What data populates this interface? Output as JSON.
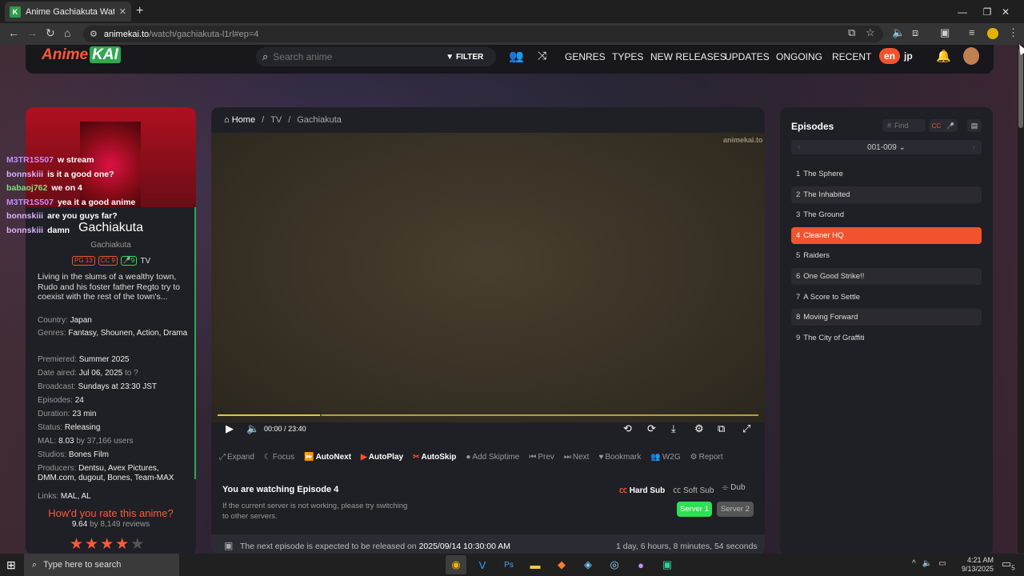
{
  "browser": {
    "tab_title": "Anime Gachiakuta Watch Online",
    "tab_favicon": "K",
    "url_host": "animekai.to",
    "url_path": "/watch/gachiakuta-l1rl#ep=4"
  },
  "site": {
    "logo_anime": "Anime",
    "logo_kai": "KAI",
    "search_placeholder": "Search anime",
    "filter_label": "FILTER",
    "nav": [
      "GENRES",
      "TYPES",
      "NEW RELEASES",
      "UPDATES",
      "ONGOING",
      "RECENT"
    ],
    "lang_en": "en",
    "lang_jp": "jp"
  },
  "anime": {
    "title": "Gachiakuta",
    "subtitle": "Gachiakuta",
    "rating_badge": "PG 13",
    "cc_badge": "CC 9",
    "dub_badge": "9",
    "type": "TV",
    "description": "Living in the slums of a wealthy town, Rudo and his foster father Regto try to coexist with the rest of the town's...",
    "meta": [
      {
        "k": "Country:",
        "v": "Japan"
      },
      {
        "k": "Genres:",
        "v": "Fantasy, Shounen, Action, Drama"
      },
      {
        "k": "Premiered:",
        "v": "Summer 2025"
      },
      {
        "k": "Date aired:",
        "v": "Jul 06, 2025",
        "extra": "to ?"
      },
      {
        "k": "Broadcast:",
        "v": "Sundays at 23:30 JST"
      },
      {
        "k": "Episodes:",
        "v": "24"
      },
      {
        "k": "Duration:",
        "v": "23 min"
      },
      {
        "k": "Status:",
        "v": "Releasing"
      },
      {
        "k": "MAL:",
        "v": "8.03",
        "extra": "by 37,166 users"
      },
      {
        "k": "Studios:",
        "v": "Bones Film"
      },
      {
        "k": "Producers:",
        "v": "Dentsu, Avex Pictures, DMM.com, dugout, Bones, Team-MAX"
      },
      {
        "k": "Links:",
        "v": "MAL, AL"
      }
    ],
    "rate_heading": "How'd you rate this anime?",
    "rate_score": "9.64",
    "rate_reviews": "by 8,149 reviews",
    "stars_filled": 4,
    "stars_total": 5
  },
  "chat": [
    {
      "user": "M3TR1S507",
      "msg": "w stream",
      "color": "#c58cff"
    },
    {
      "user": "bonnskiii",
      "msg": "is it a good one?",
      "color": "#d9b3ff"
    },
    {
      "user": "babaoj762",
      "msg": "we on 4",
      "color": "#7fe07f"
    },
    {
      "user": "M3TR1S507",
      "msg": "yea it a good anime",
      "color": "#c58cff"
    },
    {
      "user": "bonnskiii",
      "msg": "are you guys far?",
      "color": "#d9b3ff"
    },
    {
      "user": "bonnskiii",
      "msg": "damn",
      "color": "#d9b3ff"
    }
  ],
  "player": {
    "breadcrumb": [
      "Home",
      "TV",
      "Gachiakuta"
    ],
    "watermark": "animekai.to",
    "time_current": "00:00",
    "time_sep": "/",
    "time_total": "23:40",
    "progress_fraction": 0.19,
    "actions": [
      {
        "label": "Expand",
        "icon": "expand-icon",
        "glyph": "⤢",
        "on": false
      },
      {
        "label": "Focus",
        "icon": "moon-icon",
        "glyph": "☾",
        "on": false
      },
      {
        "label": "AutoNext",
        "icon": "fast-forward-icon",
        "glyph": "⏩",
        "on": true
      },
      {
        "label": "AutoPlay",
        "icon": "play-circle-icon",
        "glyph": "▶",
        "on": true
      },
      {
        "label": "AutoSkip",
        "icon": "scissors-icon",
        "glyph": "✂",
        "on": true
      },
      {
        "label": "Add Skiptime",
        "icon": "bell-icon",
        "glyph": "●",
        "on": false
      },
      {
        "label": "Prev",
        "icon": "prev-icon",
        "glyph": "⏮",
        "on": false
      },
      {
        "label": "Next",
        "icon": "next-icon",
        "glyph": "⏭",
        "on": false
      },
      {
        "label": "Bookmark",
        "icon": "heart-icon",
        "glyph": "♥",
        "on": false
      },
      {
        "label": "W2G",
        "icon": "group-icon",
        "glyph": "👥",
        "on": false
      },
      {
        "label": "Report",
        "icon": "gear-icon",
        "glyph": "⚙",
        "on": false
      }
    ],
    "watching": "You are watching Episode 4",
    "hard_sub": "Hard Sub",
    "soft_sub": "Soft Sub",
    "dub": "Dub",
    "server_note": "If the current server is not working, please try switching to other servers.",
    "server1": "Server 1",
    "server2": "Server 2",
    "next_prefix": "The next episode is expected to be released on",
    "next_date": "2025/09/14 10:30:00 AM",
    "countdown": "1 day, 6 hours, 8 minutes, 54 seconds"
  },
  "episodes": {
    "heading": "Episodes",
    "find_placeholder": "Find",
    "range": "001-009",
    "active": 4,
    "items": [
      {
        "n": "1",
        "t": "The Sphere"
      },
      {
        "n": "2",
        "t": "The Inhabited"
      },
      {
        "n": "3",
        "t": "The Ground"
      },
      {
        "n": "4",
        "t": "Cleaner HQ"
      },
      {
        "n": "5",
        "t": "Raiders"
      },
      {
        "n": "6",
        "t": "One Good Strike!!"
      },
      {
        "n": "7",
        "t": "A Score to Settle"
      },
      {
        "n": "8",
        "t": "Moving Forward"
      },
      {
        "n": "9",
        "t": "The City of Graffiti"
      }
    ]
  },
  "taskbar": {
    "search_placeholder": "Type here to search",
    "time": "4:21 AM",
    "date": "9/13/2025",
    "notif_count": "5"
  },
  "colors": {
    "accent": "#f0532e",
    "green": "#2ee052"
  }
}
